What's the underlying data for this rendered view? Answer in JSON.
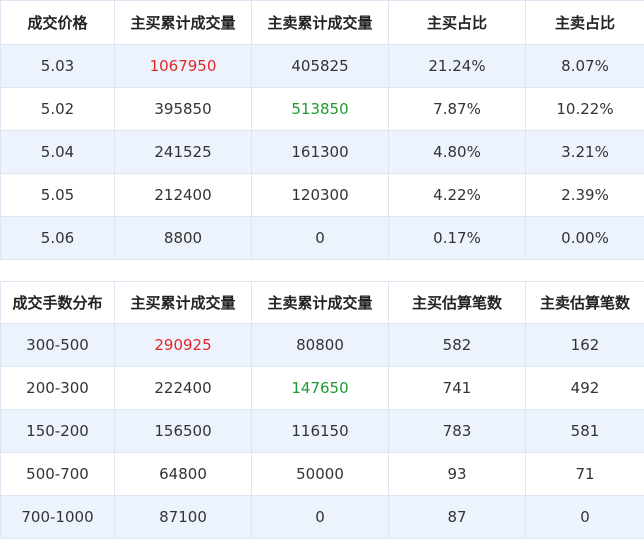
{
  "table1": {
    "headers": [
      "成交价格",
      "主买累计成交量",
      "主卖累计成交量",
      "主买占比",
      "主卖占比"
    ],
    "rows": [
      [
        "5.03",
        "1067950",
        "405825",
        "21.24%",
        "8.07%"
      ],
      [
        "5.02",
        "395850",
        "513850",
        "7.87%",
        "10.22%"
      ],
      [
        "5.04",
        "241525",
        "161300",
        "4.80%",
        "3.21%"
      ],
      [
        "5.05",
        "212400",
        "120300",
        "4.22%",
        "2.39%"
      ],
      [
        "5.06",
        "8800",
        "0",
        "0.17%",
        "0.00%"
      ]
    ]
  },
  "table2": {
    "headers": [
      "成交手数分布",
      "主买累计成交量",
      "主卖累计成交量",
      "主买估算笔数",
      "主卖估算笔数"
    ],
    "rows": [
      [
        "300-500",
        "290925",
        "80800",
        "582",
        "162"
      ],
      [
        "200-300",
        "222400",
        "147650",
        "741",
        "492"
      ],
      [
        "150-200",
        "156500",
        "116150",
        "783",
        "581"
      ],
      [
        "500-700",
        "64800",
        "50000",
        "93",
        "71"
      ],
      [
        "700-1000",
        "87100",
        "0",
        "87",
        "0"
      ]
    ]
  },
  "colors": {
    "highlight_buy": "#e3262a",
    "highlight_sell": "#1e9a32",
    "row_alt_background": "#edf3fd",
    "border": "#dde6f2"
  }
}
